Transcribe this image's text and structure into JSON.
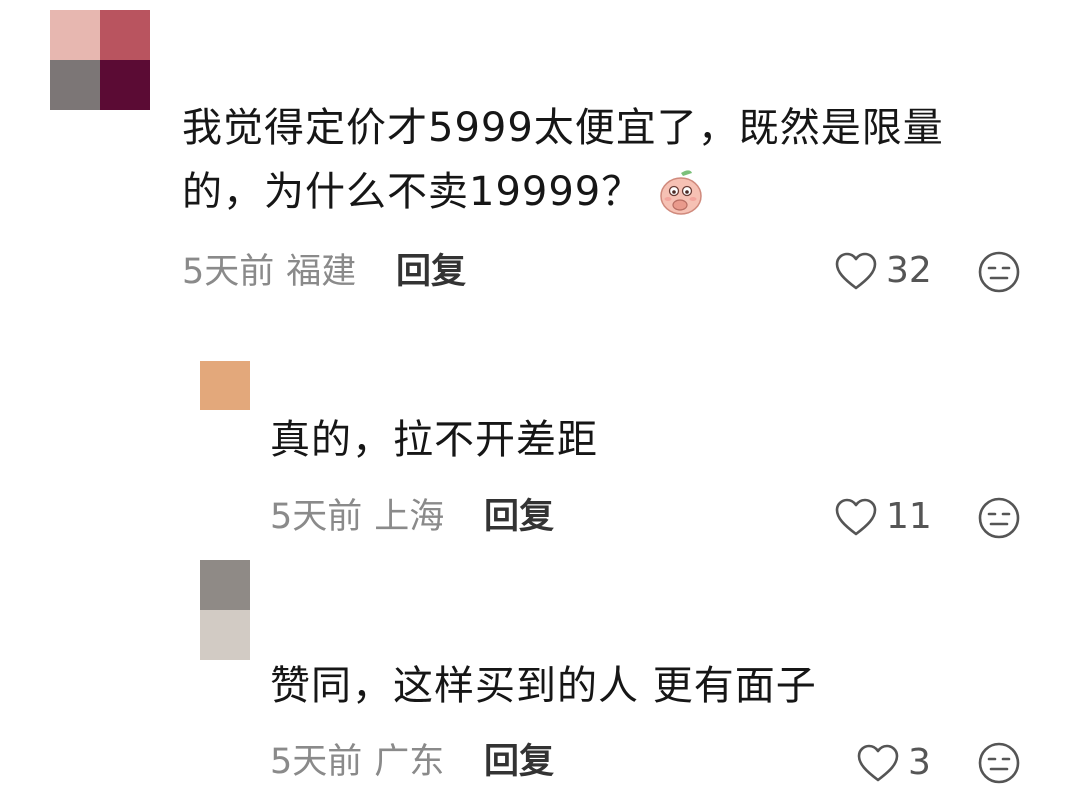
{
  "comments": [
    {
      "avatar_colors": [
        "#e7b7b0",
        "#b9545f",
        "#7c7676",
        "#5b0b34"
      ],
      "text_line1": "我觉得定价才5999太便宜了，既然是限量",
      "text_line2": "的，为什么不卖19999？",
      "emoji_icon": "peach-face-emoji",
      "time": "5天前",
      "location": "福建",
      "reply_label": "回复",
      "likes": "32"
    },
    {
      "avatar_colors": [
        "#ffffff",
        "#ffffff",
        "#e3a87b",
        "#e3a87b"
      ],
      "text_line1": "真的，拉不开差距",
      "time": "5天前",
      "location": "上海",
      "reply_label": "回复",
      "likes": "11"
    },
    {
      "avatar_colors": [
        "#8f8a86",
        "#8f8a86",
        "#d2cbc4",
        "#d2cbc4"
      ],
      "text_line1": "赞同，这样买到的人 更有面子",
      "time": "5天前",
      "location": "广东",
      "reply_label": "回复",
      "likes": "3"
    }
  ],
  "icons": {
    "like": "heart-outline-icon",
    "dislike": "neutral-face-icon"
  },
  "colors": {
    "meta_text": "#8a8a8a",
    "icon_stroke": "#555555"
  }
}
